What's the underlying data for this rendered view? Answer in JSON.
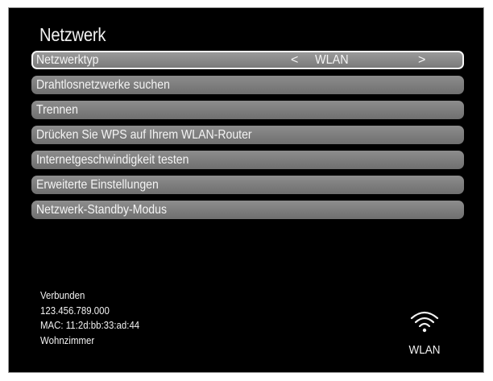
{
  "screen": {
    "title": "Netzwerk"
  },
  "menu": {
    "items": [
      {
        "label": "Netzwerktyp"
      },
      {
        "label": "Drahtlosnetzwerke suchen"
      },
      {
        "label": "Trennen"
      },
      {
        "label": "Drücken Sie WPS auf Ihrem WLAN-Router"
      },
      {
        "label": "Internetgeschwindigkeit testen"
      },
      {
        "label": "Erweiterte Einstellungen"
      },
      {
        "label": "Netzwerk-Standby-Modus"
      }
    ],
    "network_type": {
      "left_arrow": "<",
      "value": "WLAN",
      "right_arrow": ">"
    }
  },
  "status": {
    "connection": "Verbunden",
    "ip": "123.456.789.000",
    "mac": "MAC: 11:2d:bb:33:ad:44",
    "location": "Wohnzimmer"
  },
  "wifi": {
    "icon": "wifi-icon",
    "label": "WLAN"
  },
  "colors": {
    "background": "#000000",
    "item": "#7f7f7f",
    "text": "#f4f4f4",
    "selected_border": "#f5f5f5"
  }
}
